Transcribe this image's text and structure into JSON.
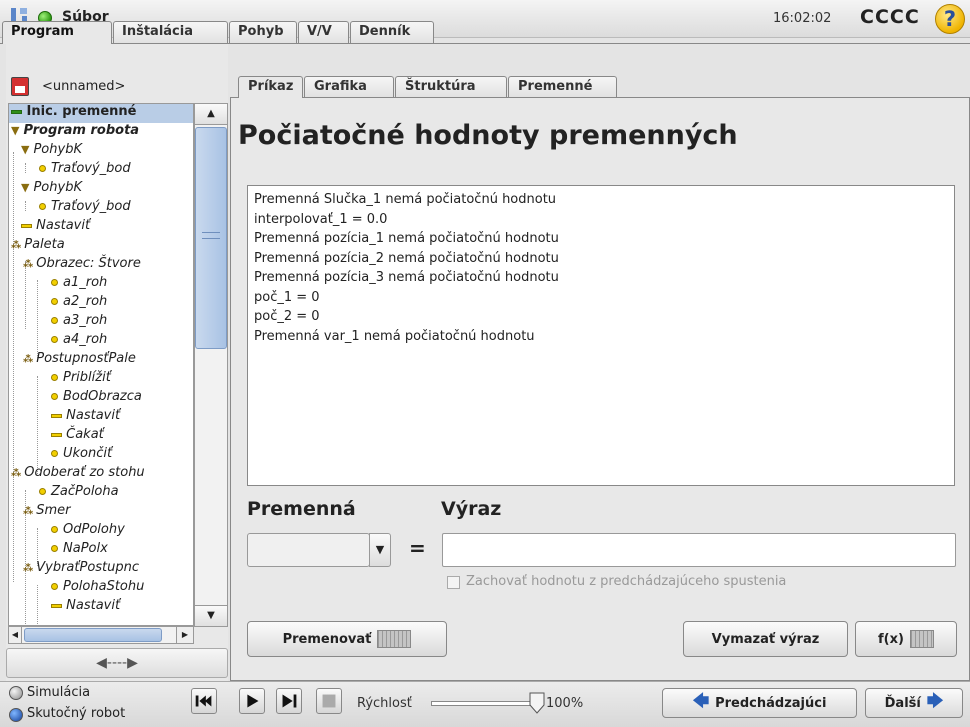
{
  "topbar": {
    "title": "Súbor",
    "clock": "16:02:02",
    "robot_name": "CCCC",
    "help_label": "?"
  },
  "main_tabs": [
    "Program",
    "Inštalácia",
    "Pohyb",
    "V/V",
    "Denník"
  ],
  "left": {
    "program_name": "<unnamed>"
  },
  "tree": [
    {
      "label": "Inic. premenné",
      "selected": true
    },
    {
      "label": "Program robota",
      "bold": true
    },
    {
      "label": "PohybK"
    },
    {
      "label": "Traťový_bod"
    },
    {
      "label": "PohybK"
    },
    {
      "label": "Traťový_bod"
    },
    {
      "label": "Nastaviť"
    },
    {
      "label": "Paleta"
    },
    {
      "label": "Obrazec: Štvore"
    },
    {
      "label": "a1_roh"
    },
    {
      "label": "a2_roh"
    },
    {
      "label": "a3_roh"
    },
    {
      "label": "a4_roh"
    },
    {
      "label": "PostupnosťPale"
    },
    {
      "label": "Priblížiť"
    },
    {
      "label": "BodObrazca"
    },
    {
      "label": "Nastaviť"
    },
    {
      "label": "Čakať"
    },
    {
      "label": "Ukončiť"
    },
    {
      "label": "Odoberať zo stohu"
    },
    {
      "label": "ZačPoloha"
    },
    {
      "label": "Smer"
    },
    {
      "label": "OdPolohy"
    },
    {
      "label": "NaPolx"
    },
    {
      "label": "VybraťPostupnc"
    },
    {
      "label": "PolohaStohu"
    },
    {
      "label": "Nastaviť"
    }
  ],
  "sub_tabs": [
    "Príkaz",
    "Grafika",
    "Štruktúra",
    "Premenné"
  ],
  "main": {
    "title": "Počiatočné hodnoty premenných",
    "lines": [
      "Premenná Slučka_1 nemá počiatočnú hodnotu",
      "interpolovať_1 = 0.0",
      "Premenná pozícia_1 nemá počiatočnú hodnotu",
      "Premenná pozícia_2 nemá počiatočnú hodnotu",
      "Premenná pozícia_3 nemá počiatočnú hodnotu",
      "poč_1 = 0",
      "poč_2 = 0",
      "Premenná var_1 nemá počiatočnú hodnotu"
    ],
    "var_label": "Premenná",
    "expr_label": "Výraz",
    "equals": "=",
    "keep_label": "Zachovať hodnotu z predchádzajúceho spustenia",
    "rename_label": "Premenovať",
    "clear_label": "Vymazať výraz",
    "fx_label": "f(x)"
  },
  "bottom": {
    "sim_label": "Simulácia",
    "real_label": "Skutočný robot",
    "speed_label": "Rýchlosť",
    "speed_value": "100%",
    "speed_fraction": 1.0,
    "prev_label": "Predchádzajúci",
    "next_label": "Ďalší"
  },
  "colors": {
    "accent": "#2a60b8",
    "selection": "#b9cde6",
    "status_led": "#2f9a14"
  },
  "icons": [
    "ur-logo-icon",
    "status-led-icon",
    "help-icon",
    "save-icon",
    "keyboard-icon",
    "play-icon",
    "stop-icon",
    "step-icon",
    "rewind-icon"
  ]
}
